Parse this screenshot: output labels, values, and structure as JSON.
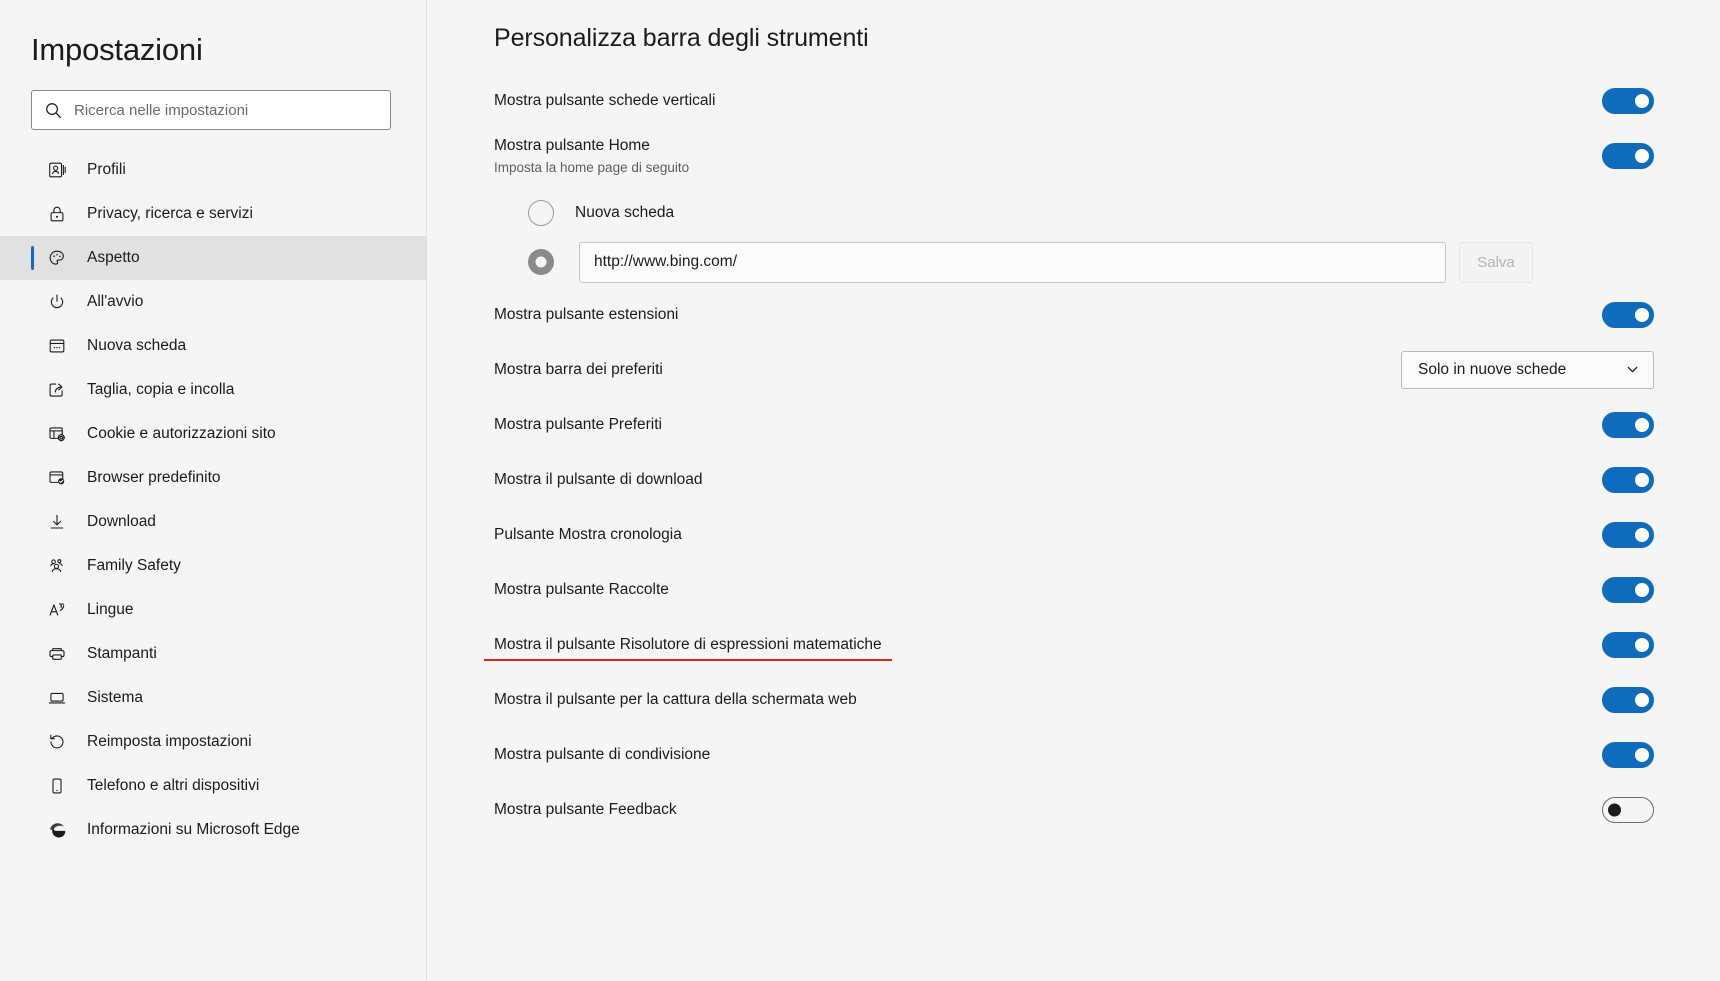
{
  "sidebar": {
    "title": "Impostazioni",
    "search": {
      "placeholder": "Ricerca nelle impostazioni",
      "value": "",
      "icon": "search-icon"
    },
    "items": [
      {
        "label": "Profili",
        "icon": "profile-card-icon",
        "active": false
      },
      {
        "label": "Privacy, ricerca e servizi",
        "icon": "lock-icon",
        "active": false
      },
      {
        "label": "Aspetto",
        "icon": "palette-icon",
        "active": true
      },
      {
        "label": "All'avvio",
        "icon": "power-icon",
        "active": false
      },
      {
        "label": "Nuova scheda",
        "icon": "new-tab-icon",
        "active": false
      },
      {
        "label": "Taglia, copia e incolla",
        "icon": "share-box-icon",
        "active": false
      },
      {
        "label": "Cookie e autorizzazioni sito",
        "icon": "site-permissions-icon",
        "active": false
      },
      {
        "label": "Browser predefinito",
        "icon": "default-browser-icon",
        "active": false
      },
      {
        "label": "Download",
        "icon": "download-arrow-icon",
        "active": false
      },
      {
        "label": "Family Safety",
        "icon": "people-icon",
        "active": false
      },
      {
        "label": "Lingue",
        "icon": "language-a-icon",
        "active": false
      },
      {
        "label": "Stampanti",
        "icon": "printer-icon",
        "active": false
      },
      {
        "label": "Sistema",
        "icon": "laptop-icon",
        "active": false
      },
      {
        "label": "Reimposta impostazioni",
        "icon": "reset-arrow-icon",
        "active": false
      },
      {
        "label": "Telefono e altri dispositivi",
        "icon": "phone-icon",
        "active": false
      },
      {
        "label": "Informazioni su Microsoft Edge",
        "icon": "edge-logo-icon",
        "active": false
      }
    ]
  },
  "main": {
    "page_title": "Personalizza barra degli strumenti",
    "rows": [
      {
        "label": "Mostra pulsante schede verticali",
        "control": "toggle",
        "state": "on"
      },
      {
        "label": "Mostra pulsante Home",
        "sub": "Imposta la home page di seguito",
        "control": "toggle",
        "state": "on"
      },
      {
        "label": "Mostra pulsante estensioni",
        "control": "toggle",
        "state": "on"
      },
      {
        "label": "Mostra barra dei preferiti",
        "control": "dropdown",
        "value": "Solo in nuove schede"
      },
      {
        "label": "Mostra pulsante Preferiti",
        "control": "toggle",
        "state": "on"
      },
      {
        "label": "Mostra il pulsante di download",
        "control": "toggle",
        "state": "on"
      },
      {
        "label": "Pulsante Mostra cronologia",
        "control": "toggle",
        "state": "on"
      },
      {
        "label": "Mostra pulsante Raccolte",
        "control": "toggle",
        "state": "on"
      },
      {
        "label": "Mostra il pulsante Risolutore di espressioni matematiche",
        "control": "toggle",
        "state": "on",
        "underline": true
      },
      {
        "label": "Mostra il pulsante per la cattura della schermata web",
        "control": "toggle",
        "state": "on"
      },
      {
        "label": "Mostra pulsante di condivisione",
        "control": "toggle",
        "state": "on"
      },
      {
        "label": "Mostra pulsante Feedback",
        "control": "toggle",
        "state": "off"
      }
    ],
    "home_page": {
      "option_new_tab": "Nuova scheda",
      "url_value": "http://www.bing.com/",
      "save_label": "Salva",
      "selected": "url"
    }
  },
  "colors": {
    "accent": "#0f6cbd",
    "highlight_underline": "#d32b1e",
    "sidebar_bg": "#f5f5f5",
    "active_item_bg": "#e1e1e1",
    "text": "#1b1b1b",
    "subtext": "#5e5e5e"
  }
}
